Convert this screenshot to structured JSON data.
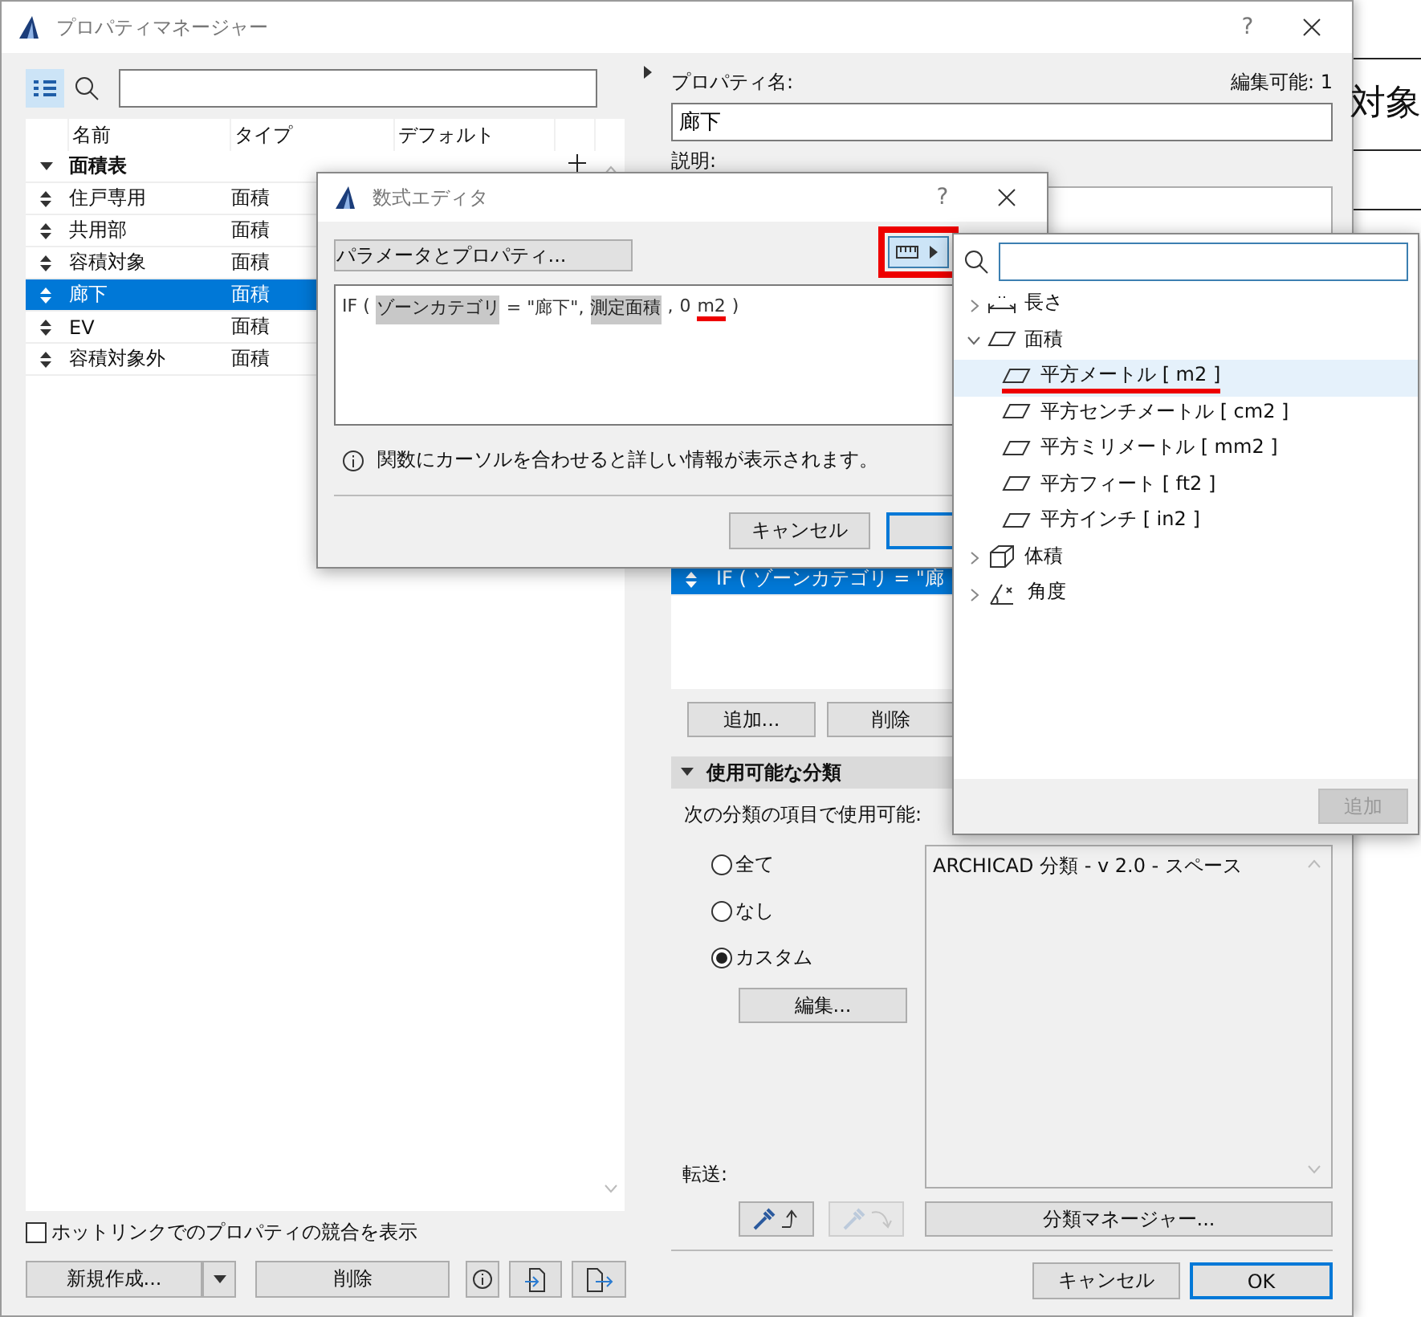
{
  "background": {
    "text": "対象"
  },
  "window": {
    "title": "プロパティマネージャー",
    "help": "?"
  },
  "left_pane": {
    "columns": [
      "名前",
      "タイプ",
      "デフォルト"
    ],
    "groups": [
      {
        "name": "面積表",
        "expanded": true,
        "rows": [
          {
            "name": "住戸専用",
            "type": "面積",
            "selected": false
          },
          {
            "name": "共用部",
            "type": "面積",
            "selected": false
          },
          {
            "name": "容積対象",
            "type": "面積",
            "selected": false
          },
          {
            "name": "廊下",
            "type": "面積",
            "selected": true
          },
          {
            "name": "EV",
            "type": "面積",
            "selected": false
          },
          {
            "name": "容積対象外",
            "type": "面積",
            "selected": false
          }
        ]
      }
    ],
    "hotlink_checkbox": {
      "label": "ホットリンクでのプロパティの競合を表示",
      "checked": false
    },
    "new_button": "新規作成...",
    "delete_button": "削除"
  },
  "right_pane": {
    "name_label": "プロパティ名:",
    "editable": "編集可能: 1",
    "name_value": "廊下",
    "description_label": "説明:",
    "expressions": [
      {
        "text": "IF ( ゾーンカテゴリ = \"廊",
        "selected": true
      }
    ],
    "add_button": "追加...",
    "remove_button": "削除",
    "classification": {
      "title": "使用可能な分類",
      "expanded": true,
      "available_label": "次の分類の項目で使用可能:",
      "radios": [
        {
          "label": "全て",
          "selected": false
        },
        {
          "label": "なし",
          "selected": false
        },
        {
          "label": "カスタム",
          "selected": true
        }
      ],
      "edit_button": "編集...",
      "list": [
        "ARCHICAD 分類 - v 2.0 - スペース"
      ],
      "transfer_label": "転送:",
      "transfer_buttons": [
        {
          "kind": "pick",
          "disabled": false
        },
        {
          "kind": "inject",
          "disabled": true
        }
      ],
      "manager_button": "分類マネージャー..."
    },
    "cancel_button": "キャンセル",
    "ok_button": "OK"
  },
  "formula_editor": {
    "title": "数式エディタ",
    "help": "?",
    "params_button": "パラメータとプロパティ...",
    "unit_button": {
      "highlighted": true
    },
    "tokens": [
      {
        "kind": "text",
        "text": "IF (",
        "underlined": false
      },
      {
        "kind": "param",
        "text": "ゾーンカテゴリ",
        "underlined": false
      },
      {
        "kind": "text",
        "text": "= \"廊下\",",
        "underlined": false
      },
      {
        "kind": "param",
        "text": "測定面積",
        "underlined": false
      },
      {
        "kind": "text",
        "text": ",",
        "underlined": false
      },
      {
        "kind": "text",
        "text": "0",
        "underlined": false
      },
      {
        "kind": "text",
        "text": "m2",
        "underlined": true
      },
      {
        "kind": "text",
        "text": ")",
        "underlined": false
      }
    ],
    "info": "関数にカーソルを合わせると詳しい情報が表示されます。",
    "cancel_button": "キャンセル"
  },
  "unit_popup": {
    "tree": [
      {
        "kind": "length",
        "label": "長さ",
        "expanded": false,
        "selected": false,
        "underlined": false
      },
      {
        "kind": "area",
        "label": "面積",
        "expanded": true,
        "selected": false,
        "underlined": false,
        "children": [
          {
            "kind": "area",
            "label": "平方メートル [ m2 ]",
            "selected": true,
            "underlined": true
          },
          {
            "kind": "area",
            "label": "平方センチメートル [ cm2 ]",
            "selected": false,
            "underlined": false
          },
          {
            "kind": "area",
            "label": "平方ミリメートル [ mm2 ]",
            "selected": false,
            "underlined": false
          },
          {
            "kind": "area",
            "label": "平方フィート [ ft2 ]",
            "selected": false,
            "underlined": false
          },
          {
            "kind": "area",
            "label": "平方インチ [ in2 ]",
            "selected": false,
            "underlined": false
          }
        ]
      },
      {
        "kind": "volume",
        "label": "体積",
        "expanded": false,
        "selected": false,
        "underlined": false
      },
      {
        "kind": "angle",
        "label": "角度",
        "expanded": false,
        "selected": false,
        "underlined": false
      }
    ],
    "add_button": {
      "label": "追加",
      "disabled": true
    }
  }
}
